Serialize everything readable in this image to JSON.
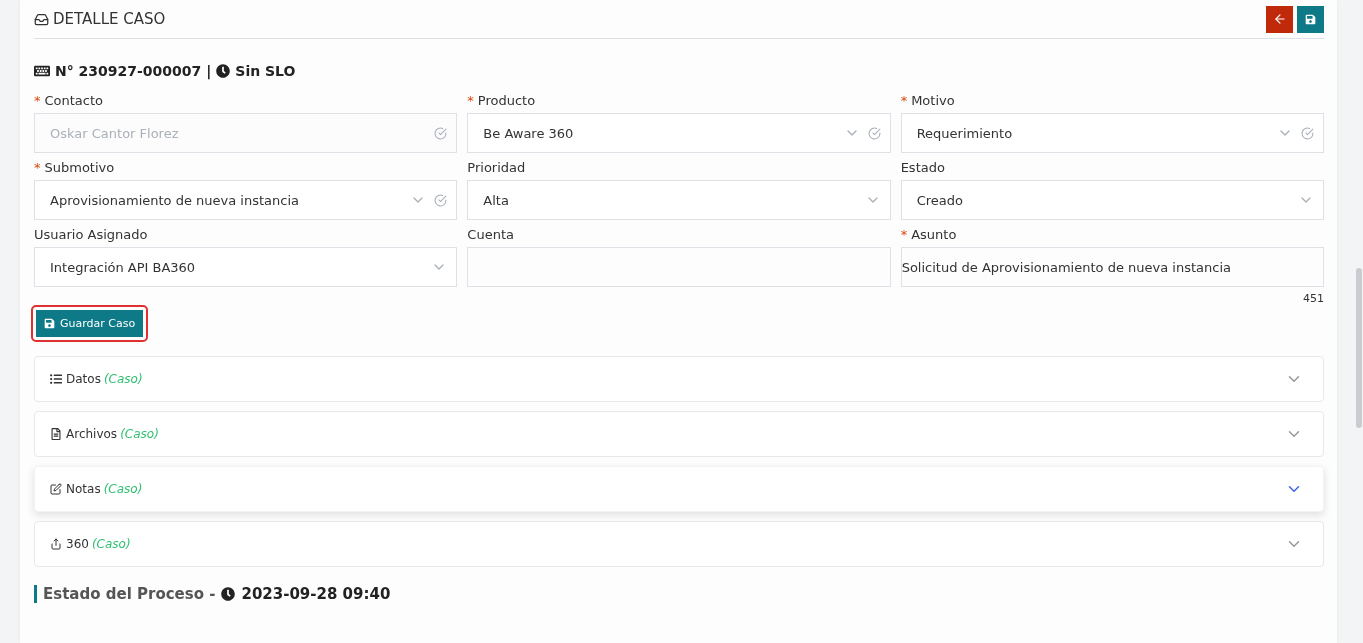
{
  "header": {
    "title": "DETALLE CASO"
  },
  "case": {
    "number": "N° 230927-000007 |",
    "slo": "Sin SLO"
  },
  "fields": [
    {
      "kind": "select",
      "marker": "*",
      "label": "Contacto",
      "value": "Oskar Cantor Florez",
      "disabled": true,
      "validated": true,
      "chevron": false
    },
    {
      "kind": "select",
      "marker": "*",
      "label": "Producto",
      "value": "Be Aware 360",
      "disabled": false,
      "validated": true,
      "chevron": true
    },
    {
      "kind": "select",
      "marker": "*",
      "label": "Motivo",
      "value": "Requerimiento",
      "disabled": false,
      "validated": true,
      "chevron": true
    },
    {
      "kind": "select",
      "marker": "*",
      "label": "Submotivo",
      "value": "Aprovisionamiento de nueva instancia",
      "disabled": false,
      "validated": true,
      "chevron": true
    },
    {
      "kind": "select",
      "label": "Prioridad",
      "value": "Alta",
      "disabled": false,
      "validated": false,
      "chevron": true
    },
    {
      "kind": "select",
      "label": "Estado",
      "value": "Creado",
      "disabled": false,
      "validated": false,
      "chevron": true
    },
    {
      "kind": "select",
      "label": "Usuario Asignado",
      "value": "Integración API BA360",
      "disabled": false,
      "validated": false,
      "chevron": true
    },
    {
      "kind": "text",
      "label": "Cuenta"
    },
    {
      "kind": "text",
      "marker": "*",
      "label": "Asunto",
      "value": "Solicitud de Aprovisionamiento de nueva instancia",
      "counter": "451"
    }
  ],
  "save_button": {
    "label": "Guardar Caso",
    "highlighted": true
  },
  "sections": [
    {
      "label": "Datos",
      "tag": "(Caso)",
      "selected": false
    },
    {
      "label": "Archivos",
      "tag": "(Caso)",
      "selected": false
    },
    {
      "label": "Notas",
      "tag": "(Caso)",
      "selected": true
    },
    {
      "label": "360",
      "tag": "(Caso)",
      "selected": false
    }
  ],
  "process": {
    "title": "Estado del Proceso -",
    "date": "2023-09-28 09:40"
  }
}
